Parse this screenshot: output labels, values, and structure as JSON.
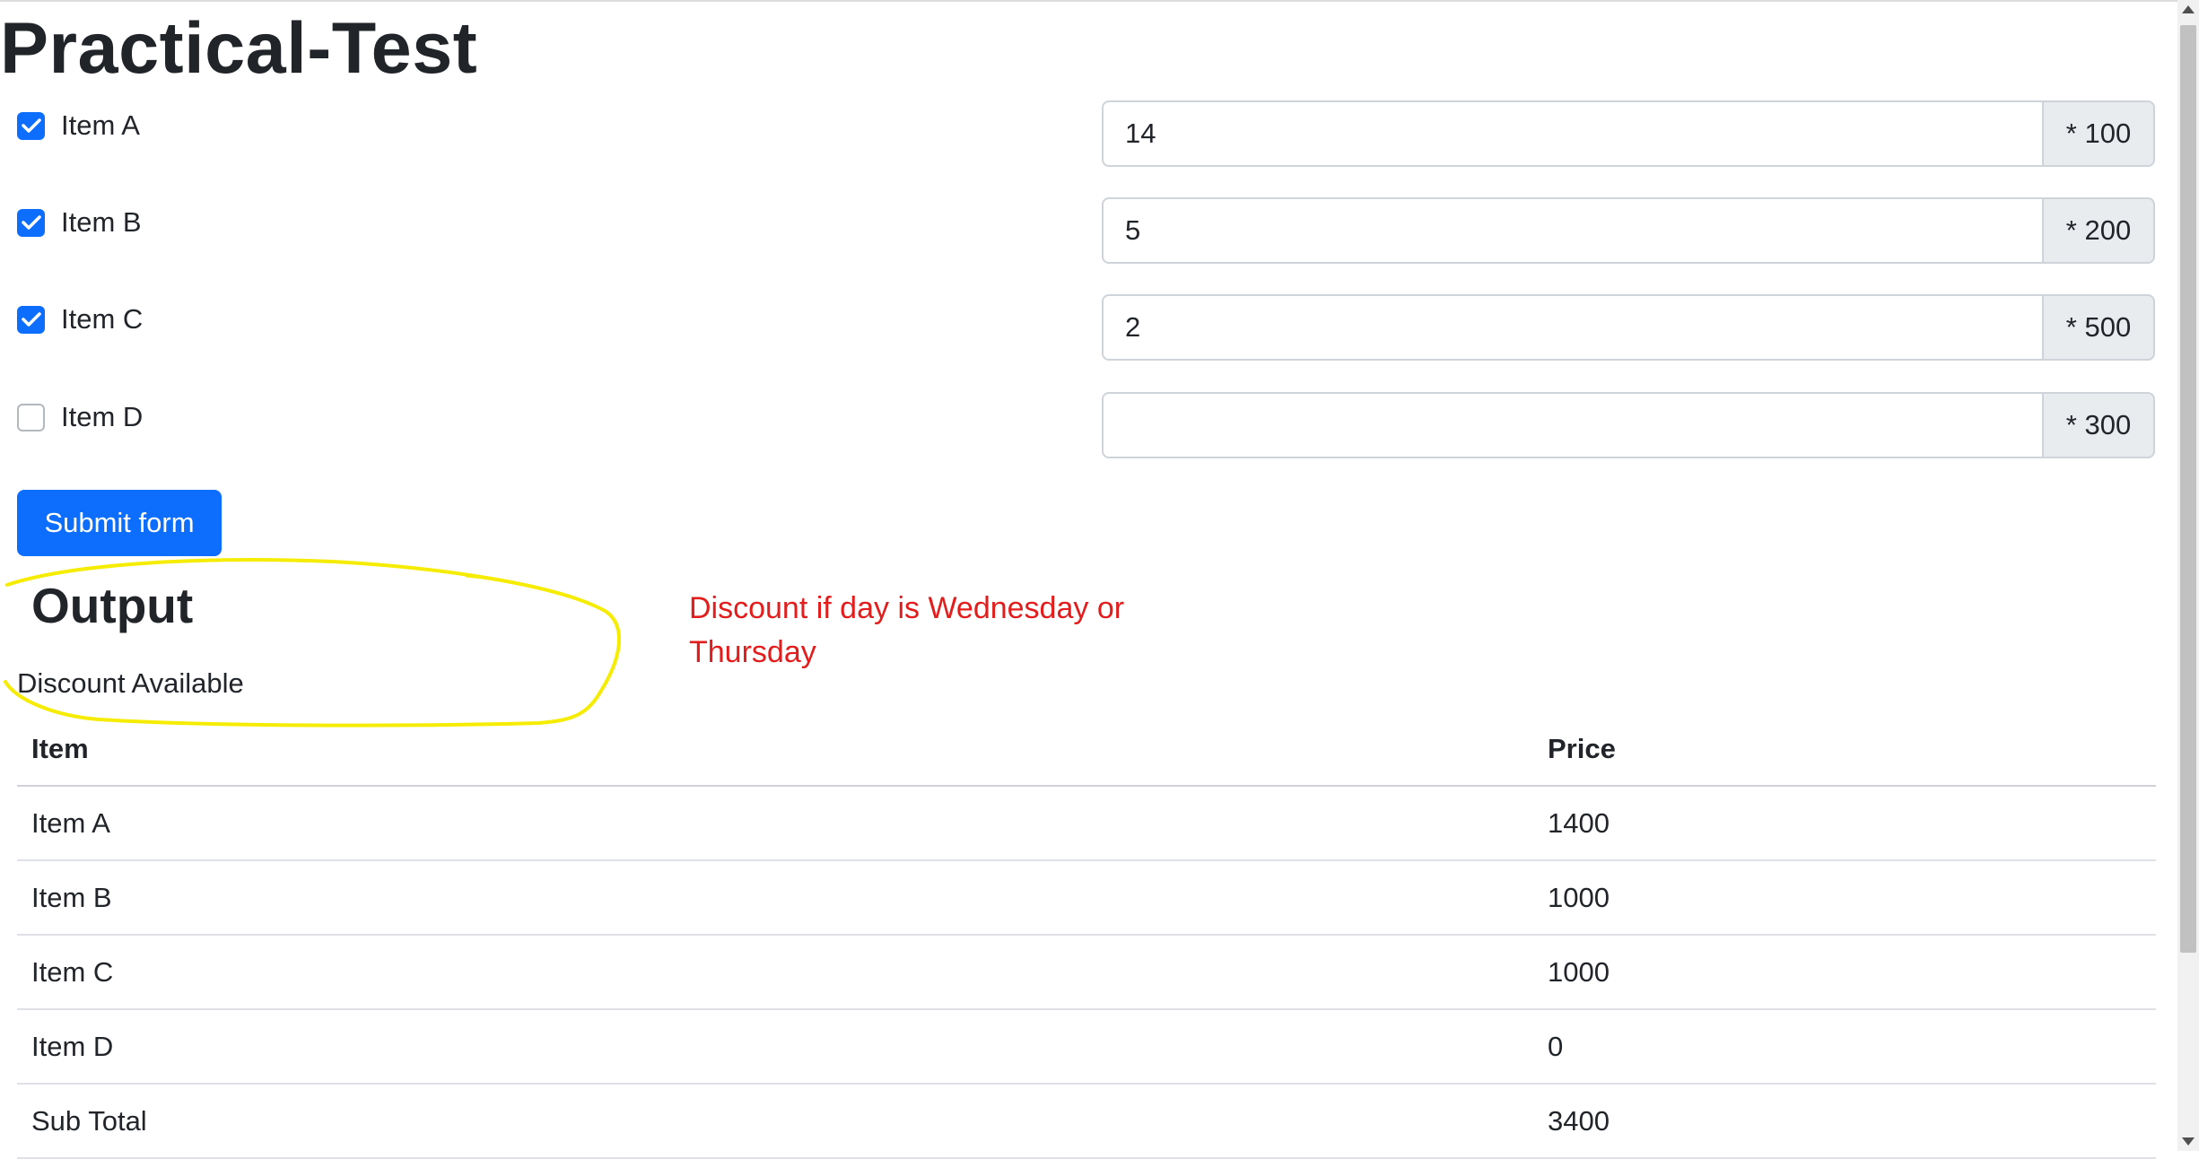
{
  "page": {
    "title": "Practical-Test"
  },
  "form": {
    "items": [
      {
        "label": "Item A",
        "checked": true,
        "quantity": "14",
        "multiplier": "* 100"
      },
      {
        "label": "Item B",
        "checked": true,
        "quantity": "5",
        "multiplier": "* 200"
      },
      {
        "label": "Item C",
        "checked": true,
        "quantity": "2",
        "multiplier": "* 500"
      },
      {
        "label": "Item D",
        "checked": false,
        "quantity": "",
        "multiplier": "* 300"
      }
    ],
    "submit_label": "Submit form"
  },
  "output": {
    "heading": "Output",
    "discount_status": "Discount Available",
    "annotation_note": "Discount if day is Wednesday or Thursday",
    "table": {
      "headers": [
        "Item",
        "Price"
      ],
      "rows": [
        [
          "Item A",
          "1400"
        ],
        [
          "Item B",
          "1000"
        ],
        [
          "Item C",
          "1000"
        ],
        [
          "Item D",
          "0"
        ],
        [
          "Sub Total",
          "3400"
        ]
      ]
    }
  },
  "colors": {
    "accent": "#0d6efd",
    "annotation_text": "#e31c1c",
    "highlight_circle": "#f5ec00"
  },
  "icons": {
    "checkbox_checked": "check-icon",
    "scroll_up": "chevron-up-icon",
    "scroll_down": "chevron-down-icon"
  }
}
